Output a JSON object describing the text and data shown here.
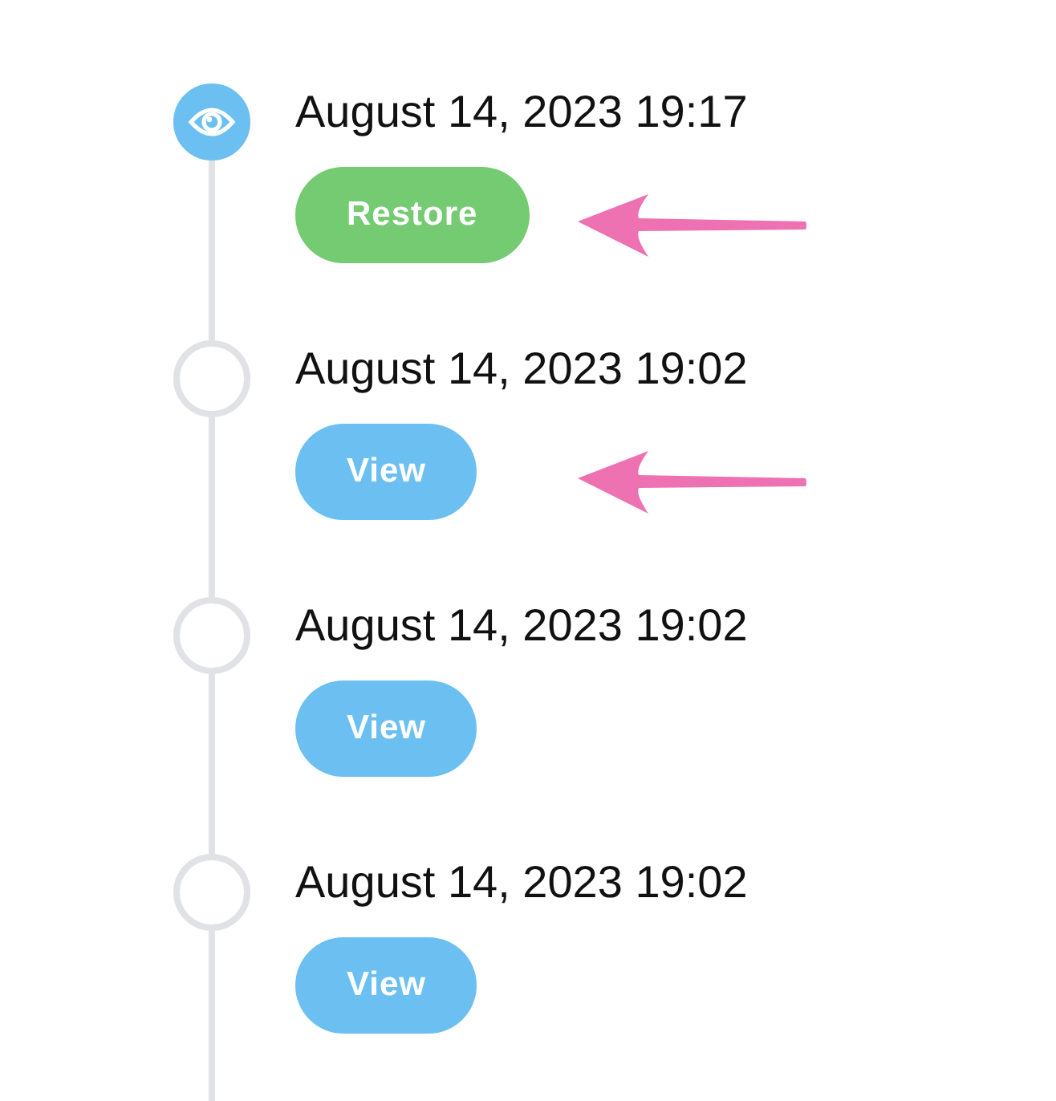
{
  "timeline": [
    {
      "timestamp": "August 14, 2023 19:17",
      "current": true,
      "marked": true,
      "button": {
        "kind": "restore",
        "label": "Restore"
      }
    },
    {
      "timestamp": "August 14, 2023 19:02",
      "current": false,
      "marked": true,
      "button": {
        "kind": "view",
        "label": "View"
      }
    },
    {
      "timestamp": "August 14, 2023 19:02",
      "current": false,
      "marked": false,
      "button": {
        "kind": "view",
        "label": "View"
      }
    },
    {
      "timestamp": "August 14, 2023 19:02",
      "current": false,
      "marked": false,
      "button": {
        "kind": "view",
        "label": "View"
      }
    }
  ]
}
